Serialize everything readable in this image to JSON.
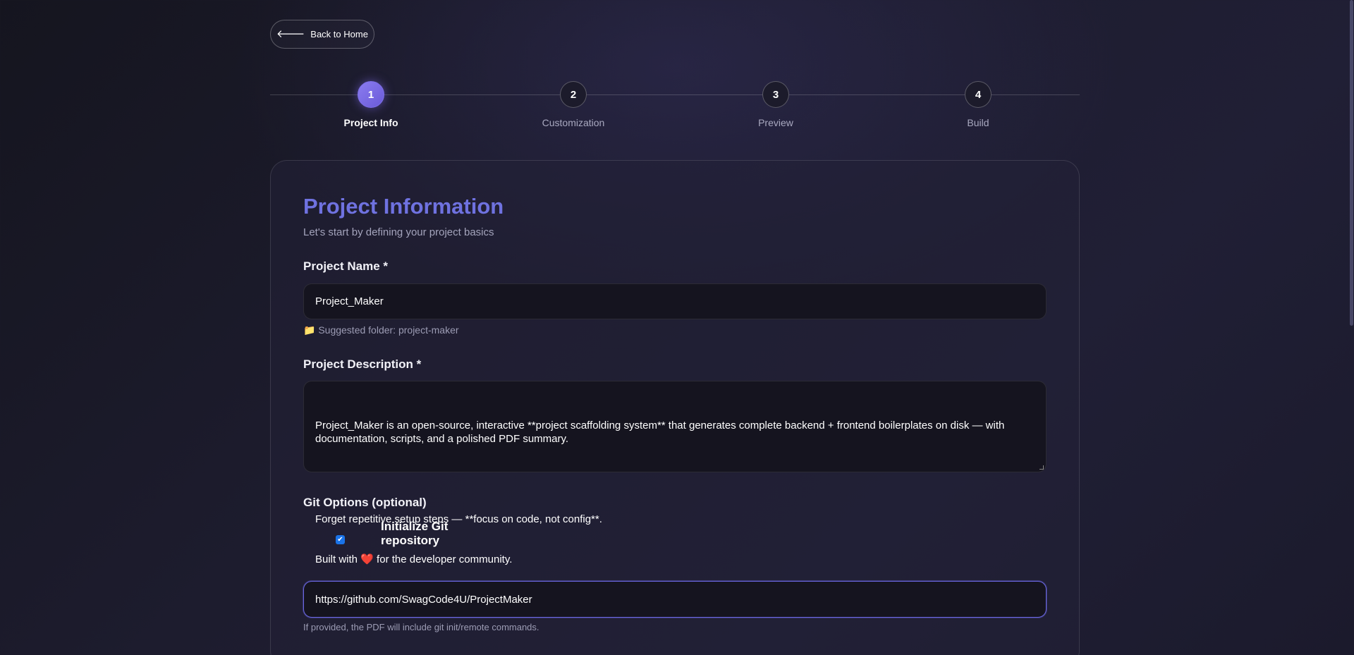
{
  "nav": {
    "back_label": "Back to Home",
    "back_icon": "arrow-left-icon"
  },
  "steps": [
    {
      "number": "1",
      "label": "Project Info",
      "active": true
    },
    {
      "number": "2",
      "label": "Customization",
      "active": false
    },
    {
      "number": "3",
      "label": "Preview",
      "active": false
    },
    {
      "number": "4",
      "label": "Build",
      "active": false
    }
  ],
  "form": {
    "title": "Project Information",
    "subtitle": "Let's start by defining your project basics",
    "project_name": {
      "label": "Project Name *",
      "value": "Project_Maker",
      "hint_icon": "folder-icon",
      "hint": "Suggested folder: project-maker"
    },
    "project_description": {
      "label": "Project Description *",
      "line1": "Project_Maker is an open-source, interactive **project scaffolding system** that generates complete backend + frontend boilerplates on disk — with documentation, scripts, and a polished PDF summary.",
      "line2": "Forget repetitive setup steps — **focus on code, not config**.",
      "line3_before": "Built with ",
      "line3_emoji": "❤️",
      "line3_after": " for the developer community."
    },
    "git": {
      "section_label": "Git Options (optional)",
      "init_checked": true,
      "init_label": "Initialize Git repository",
      "remote_url": "https://github.com/SwagCode4U/ProjectMaker",
      "remote_hint": "If provided, the PDF will include git init/remote commands."
    }
  },
  "colors": {
    "accent": "#6f72e0",
    "step_active": "#7d6fe8",
    "background": "#1d1c2e",
    "input_bg": "#15141f",
    "checkbox": "#1a73e8"
  }
}
